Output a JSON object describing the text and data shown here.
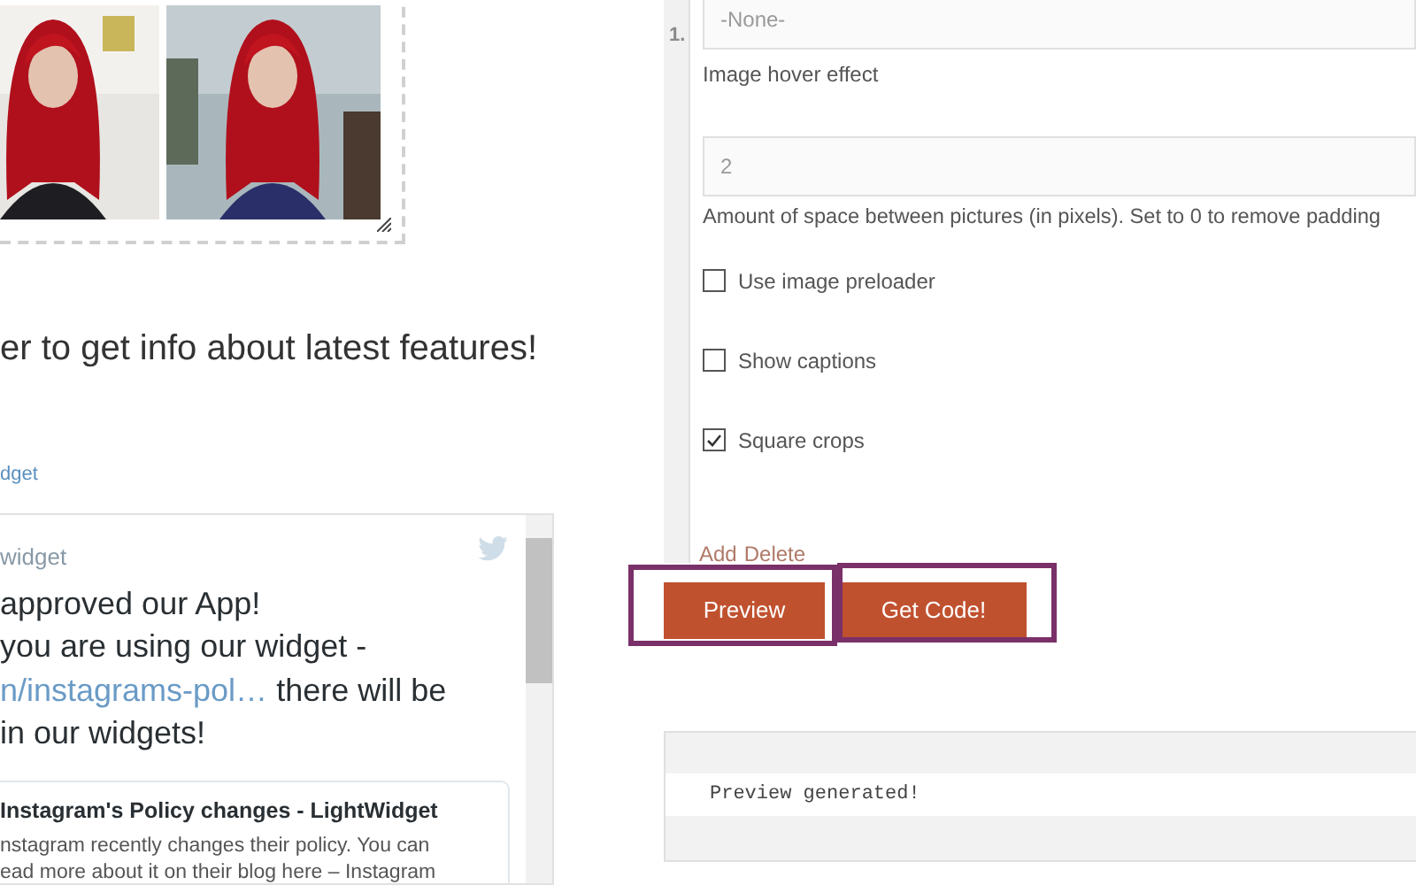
{
  "newsletter_heading": "er to get info about latest features!",
  "follow_link": "dget",
  "tweet": {
    "author": "widget",
    "lines": [
      {
        "text": "approved our App!"
      },
      {
        "text": "you are using our widget -"
      },
      {
        "link": "n/instagrams-pol…",
        "text": "there will be"
      },
      {
        "text": "in our widgets!"
      }
    ],
    "card": {
      "title": "Instagram's Policy changes - LightWidget",
      "lines": [
        "nstagram recently changes their policy. You can",
        "ead more about it on their blog here – Instagram"
      ]
    }
  },
  "settings": {
    "row_number": "1.",
    "hover_select": {
      "value": "-None-",
      "label": "Image hover effect"
    },
    "spacing": {
      "value": "2",
      "help": "Amount of space between pictures (in pixels). Set to 0 to remove padding"
    },
    "options": [
      {
        "label": "Use image preloader",
        "checked": false
      },
      {
        "label": "Show captions",
        "checked": false
      },
      {
        "label": "Square crops",
        "checked": true
      }
    ],
    "row_actions": [
      "Add",
      "Delete"
    ]
  },
  "buttons": [
    {
      "label": "Preview",
      "highlighted": true
    },
    {
      "label": "Get Code!",
      "highlighted": true
    }
  ],
  "output": {
    "message": "Preview generated!"
  }
}
